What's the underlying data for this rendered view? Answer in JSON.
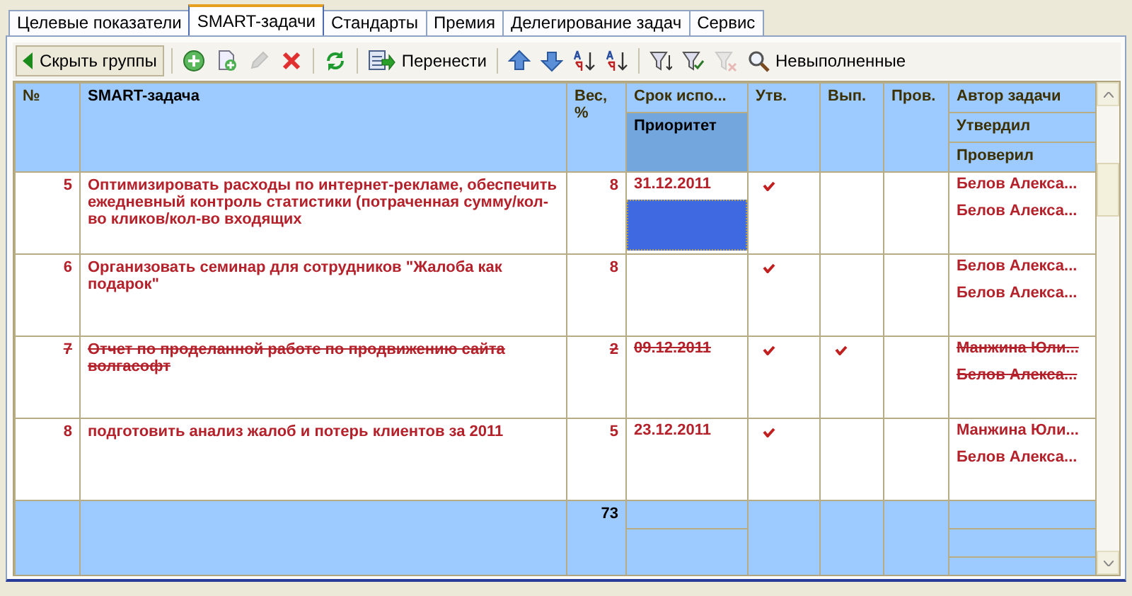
{
  "tabs": [
    {
      "label": "Целевые показатели",
      "selected": false
    },
    {
      "label": "SMART-задачи",
      "selected": true
    },
    {
      "label": "Стандарты",
      "selected": false
    },
    {
      "label": "Премия",
      "selected": false
    },
    {
      "label": "Делегирование задач",
      "selected": false
    },
    {
      "label": "Сервис",
      "selected": false
    }
  ],
  "toolbar": [
    {
      "kind": "back",
      "label": "Скрыть группы",
      "disabled": false
    },
    {
      "kind": "separator"
    },
    {
      "kind": "add",
      "disabled": false
    },
    {
      "kind": "copy",
      "disabled": false
    },
    {
      "kind": "edit",
      "disabled": true
    },
    {
      "kind": "delete",
      "disabled": false
    },
    {
      "kind": "separator"
    },
    {
      "kind": "refresh",
      "disabled": false
    },
    {
      "kind": "separator"
    },
    {
      "kind": "move",
      "label": "Перенести",
      "disabled": false
    },
    {
      "kind": "separator"
    },
    {
      "kind": "up",
      "disabled": false
    },
    {
      "kind": "down",
      "disabled": false
    },
    {
      "kind": "sort_asc",
      "disabled": false
    },
    {
      "kind": "sort_desc",
      "disabled": false
    },
    {
      "kind": "separator"
    },
    {
      "kind": "filter",
      "disabled": false
    },
    {
      "kind": "filter_check",
      "disabled": false
    },
    {
      "kind": "filter_clear",
      "disabled": true
    },
    {
      "kind": "search",
      "label": "Невыполненные",
      "disabled": false
    }
  ],
  "table": {
    "columns": {
      "number": "№",
      "task": "SMART-задача",
      "weight": "Вес, %",
      "deadline": "Срок испо...",
      "priority": "Приоритет",
      "approved": "Утв.",
      "done": "Вып.",
      "verified": "Пров.",
      "author": "Автор задачи",
      "approver": "Утвердил",
      "verifier": "Проверил"
    },
    "rows": [
      {
        "number": "5",
        "task": "Оптимизировать расходы по интернет-рекламе, обеспечить ежедневный контроль статистики (потраченная сумму/кол-во кликов/кол-во входящих",
        "weight": "8",
        "deadline": "31.12.2011",
        "priority_selected": true,
        "approved": true,
        "done": false,
        "verified": false,
        "author": "Белов Алекса...",
        "approver": "Белов Алекса...",
        "struck": false
      },
      {
        "number": "6",
        "task": "Организовать семинар для сотрудников \"Жалоба как подарок\"",
        "weight": "8",
        "priority_selected": false,
        "approved": true,
        "done": false,
        "verified": false,
        "author": "Белов Алекса...",
        "approver": "Белов Алекса...",
        "struck": false
      },
      {
        "number": "7",
        "task": "Отчет по проделанной работе по продвижению сайта волгасофт",
        "weight": "2",
        "deadline": "09.12.2011",
        "priority_selected": false,
        "approved": true,
        "done": true,
        "verified": false,
        "author": "Манжина Юли...",
        "approver": "Белов Алекса...",
        "struck": true
      },
      {
        "number": "8",
        "task": "подготовить анализ жалоб и потерь клиентов за 2011",
        "weight": "5",
        "deadline": "23.12.2011",
        "priority_selected": false,
        "approved": true,
        "done": false,
        "verified": false,
        "author": "Манжина Юли...",
        "approver": "Белов Алекса...",
        "struck": false
      }
    ],
    "total_weight": "73"
  }
}
